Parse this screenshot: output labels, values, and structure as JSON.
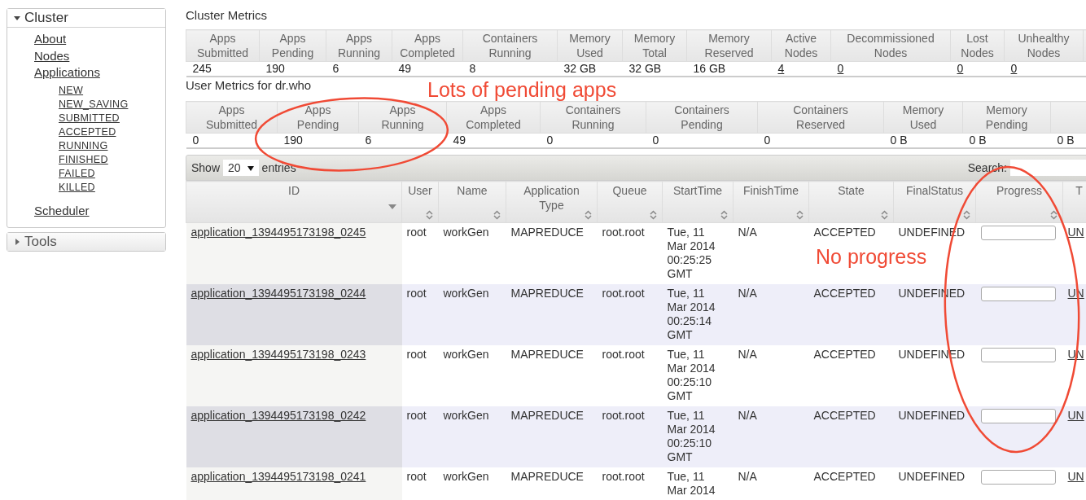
{
  "sidebar": {
    "sections": [
      {
        "title": "Cluster",
        "expanded": true,
        "items": [
          {
            "label": "About"
          },
          {
            "label": "Nodes"
          },
          {
            "label": "Applications",
            "children": [
              {
                "label": "NEW"
              },
              {
                "label": "NEW_SAVING"
              },
              {
                "label": "SUBMITTED"
              },
              {
                "label": "ACCEPTED"
              },
              {
                "label": "RUNNING"
              },
              {
                "label": "FINISHED"
              },
              {
                "label": "FAILED"
              },
              {
                "label": "KILLED"
              }
            ]
          },
          {
            "label": "Scheduler"
          }
        ]
      },
      {
        "title": "Tools",
        "expanded": false
      }
    ]
  },
  "cluster_metrics": {
    "title": "Cluster Metrics",
    "columns": [
      {
        "label": "Apps Submitted",
        "value": "245",
        "kind": "text"
      },
      {
        "label": "Apps Pending",
        "value": "190",
        "kind": "text"
      },
      {
        "label": "Apps Running",
        "value": "6",
        "kind": "text"
      },
      {
        "label": "Apps Completed",
        "value": "49",
        "kind": "text"
      },
      {
        "label": "Containers Running",
        "value": "8",
        "kind": "text"
      },
      {
        "label": "Memory Used",
        "value": "32 GB",
        "kind": "text"
      },
      {
        "label": "Memory Total",
        "value": "32 GB",
        "kind": "text"
      },
      {
        "label": "Memory Reserved",
        "value": "16 GB",
        "kind": "text"
      },
      {
        "label": "Active Nodes",
        "value": "4",
        "kind": "link"
      },
      {
        "label": "Decommissioned Nodes",
        "value": "0",
        "kind": "link"
      },
      {
        "label": "Lost Nodes",
        "value": "0",
        "kind": "link"
      },
      {
        "label": "Unhealthy Nodes",
        "value": "0",
        "kind": "link"
      }
    ]
  },
  "user_metrics": {
    "title": "User Metrics for dr.who",
    "columns": [
      {
        "label": "Apps Submitted",
        "value": "0"
      },
      {
        "label": "Apps Pending",
        "value": "190"
      },
      {
        "label": "Apps Running",
        "value": "6"
      },
      {
        "label": "Apps Completed",
        "value": "49"
      },
      {
        "label": "Containers Running",
        "value": "0"
      },
      {
        "label": "Containers Pending",
        "value": "0"
      },
      {
        "label": "Containers Reserved",
        "value": "0"
      },
      {
        "label": "Memory Used",
        "value": "0 B"
      },
      {
        "label": "Memory Pending",
        "value": "0 B"
      },
      {
        "value": "0 B"
      }
    ]
  },
  "applications": {
    "show_label": "Show",
    "page_size": "20",
    "entries_label": "entries",
    "search_label": "Search:",
    "columns": [
      {
        "label": "ID",
        "sortable": true,
        "sorted_descending": true
      },
      {
        "label": "User",
        "sortable": true,
        "sorted_descending": false
      },
      {
        "label": "Name",
        "sortable": true,
        "sorted_descending": false
      },
      {
        "label": "Application Type",
        "sortable": true,
        "sorted_descending": false
      },
      {
        "label": "Queue",
        "sortable": true,
        "sorted_descending": false
      },
      {
        "label": "StartTime",
        "sortable": true,
        "sorted_descending": false
      },
      {
        "label": "FinishTime",
        "sortable": true,
        "sorted_descending": false
      },
      {
        "label": "State",
        "sortable": true,
        "sorted_descending": false
      },
      {
        "label": "FinalStatus",
        "sortable": true,
        "sorted_descending": false
      },
      {
        "label": "Progress",
        "sortable": true,
        "sorted_descending": false
      },
      {
        "label": "T",
        "sortable": false,
        "sorted_descending": false
      }
    ],
    "rows": [
      {
        "id": "application_1394495173198_0245",
        "user": "root",
        "name": "workGen",
        "type": "MAPREDUCE",
        "queue": "root.root",
        "start_time": "Tue, 11 Mar 2014 00:25:25 GMT",
        "finish_time": "N/A",
        "state": "ACCEPTED",
        "final_status": "UNDEFINED",
        "level": 0,
        "column_11": "UN"
      },
      {
        "id": "application_1394495173198_0244",
        "user": "root",
        "name": "workGen",
        "type": "MAPREDUCE",
        "queue": "root.root",
        "start_time": "Tue, 11 Mar 2014 00:25:14 GMT",
        "finish_time": "N/A",
        "state": "ACCEPTED",
        "final_status": "UNDEFINED",
        "level": 0,
        "column_11": "UN"
      },
      {
        "id": "application_1394495173198_0243",
        "user": "root",
        "name": "workGen",
        "type": "MAPREDUCE",
        "queue": "root.root",
        "start_time": "Tue, 11 Mar 2014 00:25:10 GMT",
        "finish_time": "N/A",
        "state": "ACCEPTED",
        "final_status": "UNDEFINED",
        "level": 0,
        "column_11": "UN"
      },
      {
        "id": "application_1394495173198_0242",
        "user": "root",
        "name": "workGen",
        "type": "MAPREDUCE",
        "queue": "root.root",
        "start_time": "Tue, 11 Mar 2014 00:25:10 GMT",
        "finish_time": "N/A",
        "state": "ACCEPTED",
        "final_status": "UNDEFINED",
        "level": 0,
        "column_11": "UN"
      },
      {
        "id": "application_1394495173198_0241",
        "user": "root",
        "name": "workGen",
        "type": "MAPREDUCE",
        "queue": "root.root",
        "start_time": "Tue, 11 Mar 2014",
        "finish_time": "N/A",
        "state": "ACCEPTED",
        "final_status": "UNDEFINED",
        "level": 0,
        "column_11": "UN"
      }
    ]
  },
  "annotations": [
    {
      "text": "Lots of pending apps"
    },
    {
      "text": "No progress"
    }
  ]
}
